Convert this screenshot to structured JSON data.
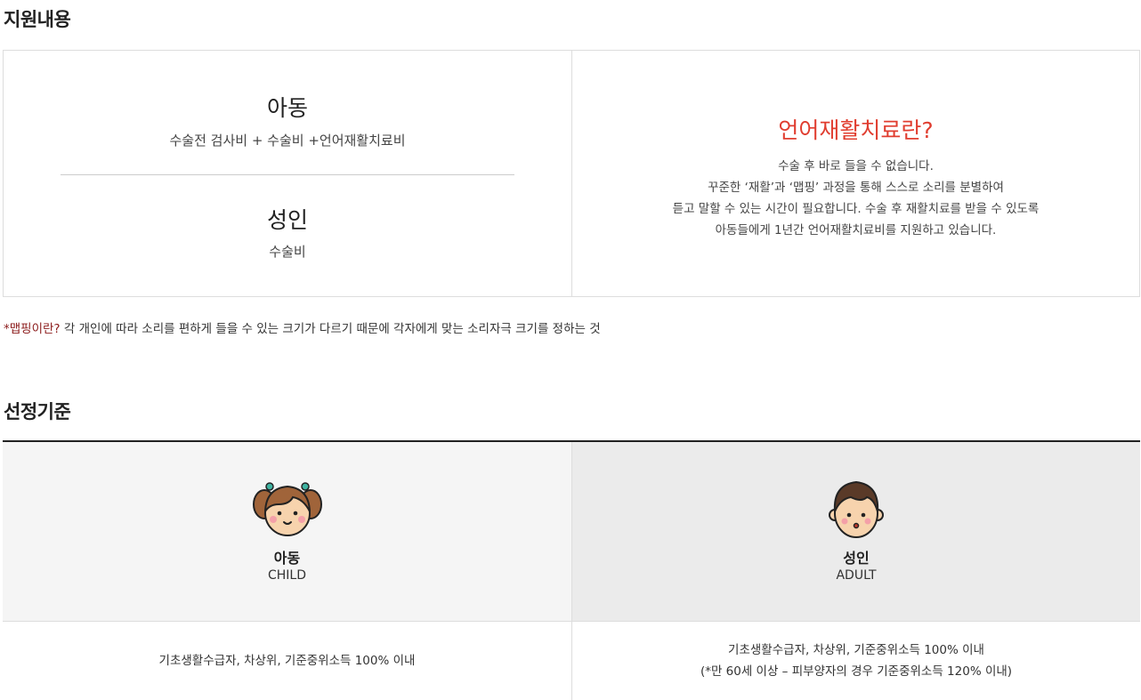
{
  "support": {
    "title": "지원내용",
    "child": {
      "label": "아동",
      "desc": "수술전 검사비 + 수술비 +언어재활치료비"
    },
    "adult": {
      "label": "성인",
      "desc": "수술비"
    },
    "speech": {
      "title": "언어재활치료란?",
      "lines": [
        "수술 후 바로 들을 수 없습니다.",
        "꾸준한 ‘재활’과 ‘맵핑’ 과정을 통해 스스로 소리를 분별하여",
        "듣고 말할 수 있는 시간이 필요합니다. 수술 후 재활치료를 받을 수 있도록",
        "아동들에게 1년간 언어재활치료비를 지원하고 있습니다."
      ]
    }
  },
  "note": {
    "key": "*맵핑이란?",
    "text": " 각 개인에 따라 소리를 편하게 들을 수 있는 크기가 다르기 때문에 각자에게 맞는 소리자극 크기를 정하는 것"
  },
  "criteria": {
    "title": "선정기준",
    "child": {
      "icon": "girl-avatar-icon",
      "label_ko": "아동",
      "label_en": "CHILD",
      "lines": [
        "기초생활수급자, 차상위, 기준중위소득 100% 이내"
      ]
    },
    "adult": {
      "icon": "boy-avatar-icon",
      "label_ko": "성인",
      "label_en": "ADULT",
      "lines": [
        "기초생활수급자, 차상위, 기준중위소득 100% 이내",
        "(*만 60세 이상 – 피부양자의 경우 기준중위소득 120% 이내)"
      ]
    }
  },
  "colors": {
    "accent": "#e03d2f",
    "note_key": "#8b1a1a",
    "child_bg": "#f5f5f5",
    "adult_bg": "#ebebeb"
  }
}
